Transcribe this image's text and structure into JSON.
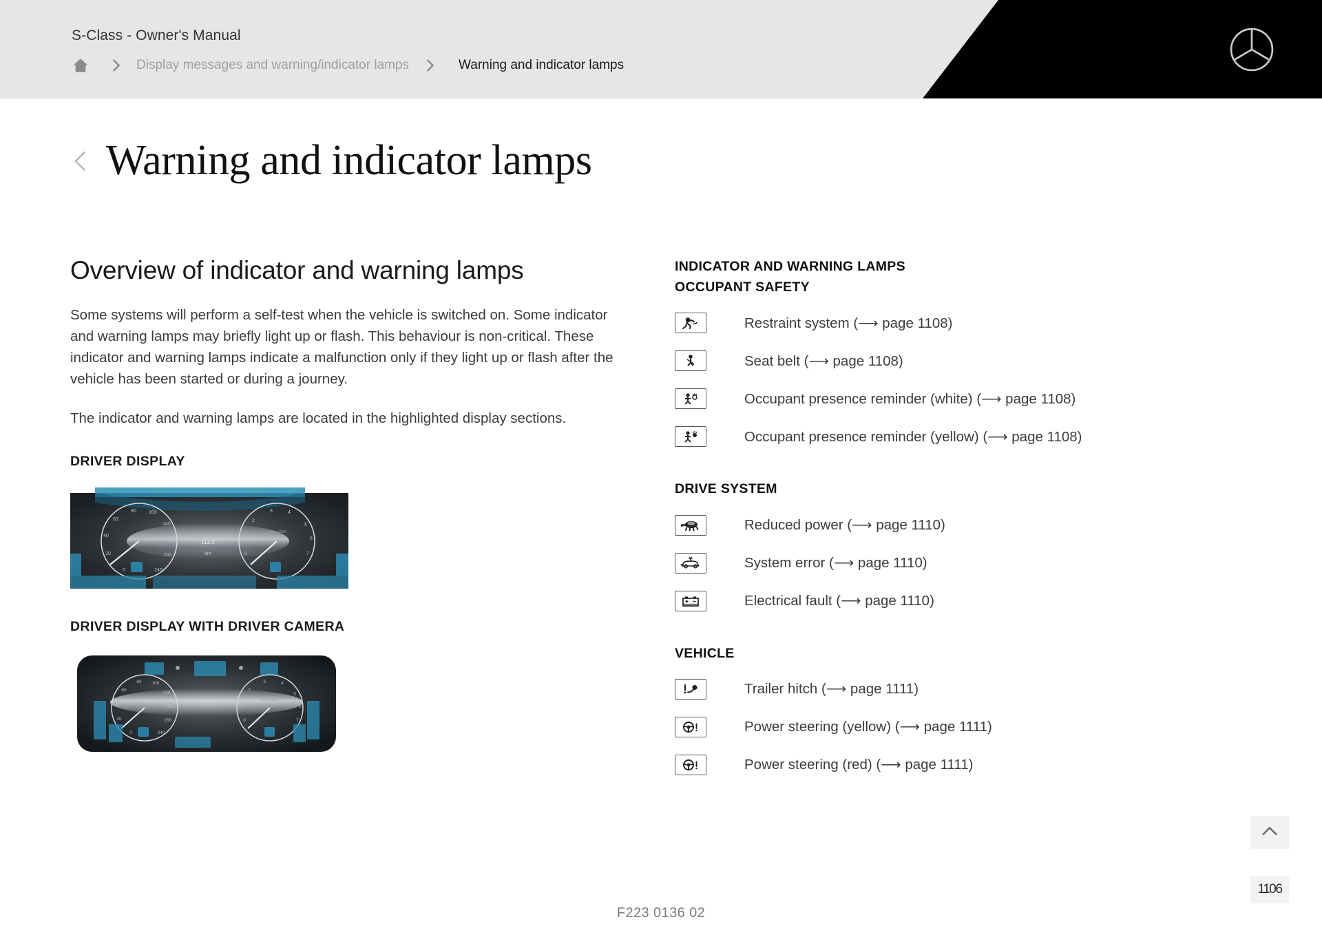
{
  "header": {
    "manual_title": "S-Class - Owner's Manual",
    "home_icon": "home-icon",
    "breadcrumb_parent": "Display messages and warning/indicator lamps",
    "breadcrumb_current": "Warning and indicator lamps",
    "brand_logo": "mercedes-benz-star-logo",
    "bg_color": "#e6e6e6",
    "black_panel_color": "#000000"
  },
  "title": {
    "text": "Warning and indicator lamps",
    "back_icon": "chevron-left-icon"
  },
  "left": {
    "heading": "Overview of indicator and warning lamps",
    "paragraph1": "Some systems will perform a self-test when the vehicle is switched on. Some indicator and warning lamps may briefly light up or flash. This behaviour is non-critical. These indicator and warning lamps indicate a malfunction only if they light up or flash after the vehicle has been started or during a journey.",
    "paragraph2": "The indicator and warning lamps are located in the highlighted display sections.",
    "figure1_caption": "DRIVER DISPLAY",
    "figure1_name": "driver-display-cluster-image",
    "figure2_caption": "DRIVER DISPLAY WITH DRIVER CAMERA",
    "figure2_name": "driver-display-with-camera-cluster-image"
  },
  "right": {
    "title_line1": "INDICATOR AND WARNING LAMPS",
    "groups": [
      {
        "title": "OCCUPANT SAFETY",
        "items": [
          {
            "icon": "restraint-system-lamp-icon",
            "label": "Restraint system (⟶ page 1108)"
          },
          {
            "icon": "seat-belt-lamp-icon",
            "label": "Seat belt (⟶ page 1108)"
          },
          {
            "icon": "occupant-presence-reminder-white-lamp-icon",
            "label": "Occupant presence reminder (white) (⟶ page 1108)"
          },
          {
            "icon": "occupant-presence-reminder-yellow-lamp-icon",
            "label": "Occupant presence reminder (yellow) (⟶ page 1108)"
          }
        ]
      },
      {
        "title": "DRIVE SYSTEM",
        "items": [
          {
            "icon": "reduced-power-turtle-lamp-icon",
            "label": "Reduced power (⟶ page 1110)"
          },
          {
            "icon": "system-error-car-wrench-lamp-icon",
            "label": "System error (⟶ page 1110)"
          },
          {
            "icon": "electrical-fault-battery-lamp-icon",
            "label": "Electrical fault (⟶ page 1110)"
          }
        ]
      },
      {
        "title": "VEHICLE",
        "items": [
          {
            "icon": "trailer-hitch-lamp-icon",
            "label": "Trailer hitch (⟶ page 1111)"
          },
          {
            "icon": "power-steering-yellow-lamp-icon",
            "label": "Power steering (yellow) (⟶ page 1111)"
          },
          {
            "icon": "power-steering-red-lamp-icon",
            "label": "Power steering (red) (⟶ page 1111)"
          }
        ]
      }
    ]
  },
  "footer": {
    "figure_code": "F223 0136 02",
    "page_number": "1106",
    "scroll_top_icon": "chevron-up-icon"
  }
}
